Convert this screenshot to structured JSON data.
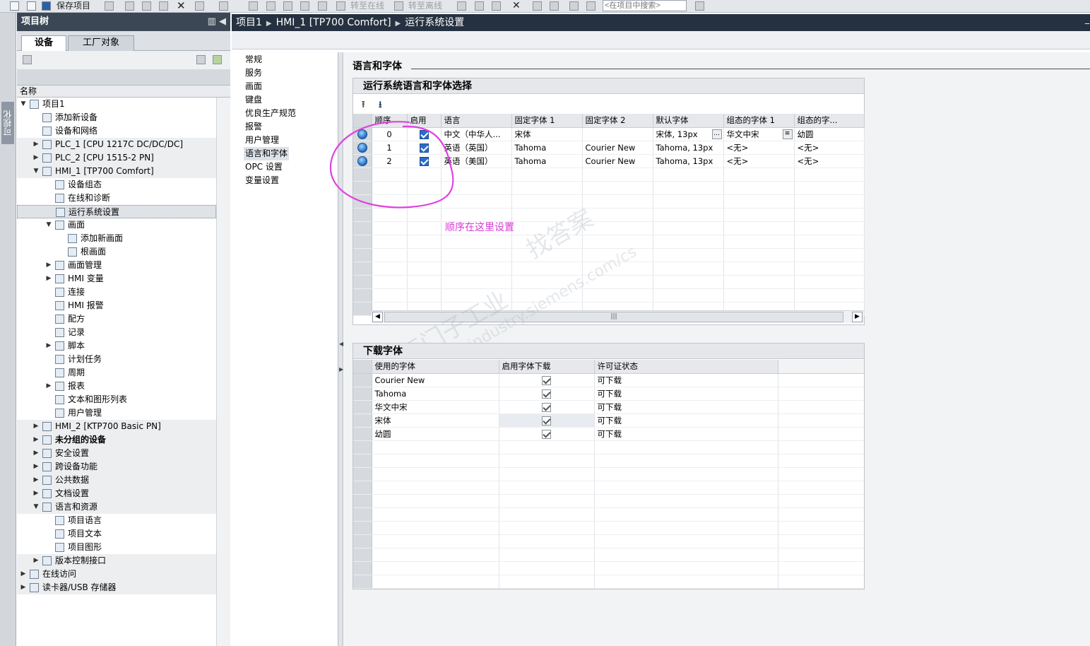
{
  "toolbar": {
    "save_label": "保存项目",
    "go_online": "转至在线",
    "go_offline": "转至离线",
    "search_placeholder": "<在项目中搜索>"
  },
  "vstrip": {
    "label": "可视化"
  },
  "tree": {
    "title": "项目树",
    "tabs": [
      "设备",
      "工厂对象"
    ],
    "header": "名称",
    "items": [
      {
        "label": "项目1",
        "level": 0,
        "arrow": "down",
        "bold": false
      },
      {
        "label": "添加新设备",
        "level": 1,
        "arrow": "",
        "bold": false
      },
      {
        "label": "设备和网络",
        "level": 1,
        "arrow": "",
        "bold": false
      },
      {
        "label": "PLC_1 [CPU 1217C DC/DC/DC]",
        "level": 1,
        "arrow": "right",
        "bold": false
      },
      {
        "label": "PLC_2 [CPU 1515-2 PN]",
        "level": 1,
        "arrow": "right",
        "bold": false
      },
      {
        "label": "HMI_1 [TP700 Comfort]",
        "level": 1,
        "arrow": "down",
        "bold": false
      },
      {
        "label": "设备组态",
        "level": 2,
        "arrow": "",
        "bold": false
      },
      {
        "label": "在线和诊断",
        "level": 2,
        "arrow": "",
        "bold": false
      },
      {
        "label": "运行系统设置",
        "level": 2,
        "arrow": "",
        "bold": false
      },
      {
        "label": "画面",
        "level": 2,
        "arrow": "down",
        "bold": false
      },
      {
        "label": "添加新画面",
        "level": 3,
        "arrow": "",
        "bold": false
      },
      {
        "label": "根画面",
        "level": 3,
        "arrow": "",
        "bold": false
      },
      {
        "label": "画面管理",
        "level": 2,
        "arrow": "right",
        "bold": false
      },
      {
        "label": "HMI 变量",
        "level": 2,
        "arrow": "right",
        "bold": false
      },
      {
        "label": "连接",
        "level": 2,
        "arrow": "",
        "bold": false
      },
      {
        "label": "HMI 报警",
        "level": 2,
        "arrow": "",
        "bold": false
      },
      {
        "label": "配方",
        "level": 2,
        "arrow": "",
        "bold": false
      },
      {
        "label": "记录",
        "level": 2,
        "arrow": "",
        "bold": false
      },
      {
        "label": "脚本",
        "level": 2,
        "arrow": "right",
        "bold": false
      },
      {
        "label": "计划任务",
        "level": 2,
        "arrow": "",
        "bold": false
      },
      {
        "label": "周期",
        "level": 2,
        "arrow": "",
        "bold": false
      },
      {
        "label": "报表",
        "level": 2,
        "arrow": "right",
        "bold": false
      },
      {
        "label": "文本和图形列表",
        "level": 2,
        "arrow": "",
        "bold": false
      },
      {
        "label": "用户管理",
        "level": 2,
        "arrow": "",
        "bold": false
      },
      {
        "label": "HMI_2 [KTP700 Basic PN]",
        "level": 1,
        "arrow": "right",
        "bold": false
      },
      {
        "label": "未分组的设备",
        "level": 1,
        "arrow": "right",
        "bold": true
      },
      {
        "label": "安全设置",
        "level": 1,
        "arrow": "right",
        "bold": false
      },
      {
        "label": "跨设备功能",
        "level": 1,
        "arrow": "right",
        "bold": false
      },
      {
        "label": "公共数据",
        "level": 1,
        "arrow": "right",
        "bold": false
      },
      {
        "label": "文档设置",
        "level": 1,
        "arrow": "right",
        "bold": false
      },
      {
        "label": "语言和资源",
        "level": 1,
        "arrow": "down",
        "bold": false
      },
      {
        "label": "项目语言",
        "level": 2,
        "arrow": "",
        "bold": false
      },
      {
        "label": "项目文本",
        "level": 2,
        "arrow": "",
        "bold": false
      },
      {
        "label": "项目图形",
        "level": 2,
        "arrow": "",
        "bold": false
      },
      {
        "label": "版本控制接口",
        "level": 1,
        "arrow": "right",
        "bold": false
      },
      {
        "label": "在线访问",
        "level": 0,
        "arrow": "right",
        "bold": false
      },
      {
        "label": "读卡器/USB 存储器",
        "level": 0,
        "arrow": "right",
        "bold": false
      }
    ]
  },
  "editor": {
    "breadcrumb": [
      "项目1",
      "HMI_1 [TP700 Comfort]",
      "运行系统设置"
    ],
    "nav": [
      "常规",
      "服务",
      "画面",
      "键盘",
      "优良生产规范",
      "报警",
      "用户管理",
      "语言和字体",
      "OPC 设置",
      "变量设置"
    ],
    "section_title": "语言和字体",
    "runtime_panel": {
      "title": "运行系统语言和字体选择",
      "columns": [
        "顺序",
        "启用",
        "语言",
        "固定字体 1",
        "固定字体 2",
        "默认字体",
        "组态的字体 1",
        "组态的字..."
      ],
      "rows": [
        {
          "order": "0",
          "enabled": true,
          "language": "中文（中华人...",
          "fixed1": "宋体",
          "fixed2": "",
          "default_font": "宋体, 13px",
          "cfg1": "华文中宋",
          "cfg2": "幼圆"
        },
        {
          "order": "1",
          "enabled": true,
          "language": "英语（英国）",
          "fixed1": "Tahoma",
          "fixed2": "Courier New",
          "default_font": "Tahoma, 13px",
          "cfg1": "<无>",
          "cfg2": "<无>"
        },
        {
          "order": "2",
          "enabled": true,
          "language": "英语（美国）",
          "fixed1": "Tahoma",
          "fixed2": "Courier New",
          "default_font": "Tahoma, 13px",
          "cfg1": "<无>",
          "cfg2": "<无>"
        }
      ],
      "annotation": "顺序在这里设置"
    },
    "download_panel": {
      "title": "下载字体",
      "columns": [
        "使用的字体",
        "启用字体下载",
        "许可证状态"
      ],
      "rows": [
        {
          "font": "Courier New",
          "enabled": true,
          "status": "可下载"
        },
        {
          "font": "Tahoma",
          "enabled": true,
          "status": "可下载"
        },
        {
          "font": "华文中宋",
          "enabled": true,
          "status": "可下载"
        },
        {
          "font": "宋体",
          "enabled": true,
          "status": "可下载"
        },
        {
          "font": "幼圆",
          "enabled": true,
          "status": "可下载"
        }
      ]
    },
    "watermark": [
      "西门子工业",
      "找答案",
      "support.industry.siemens.com/cs"
    ]
  }
}
